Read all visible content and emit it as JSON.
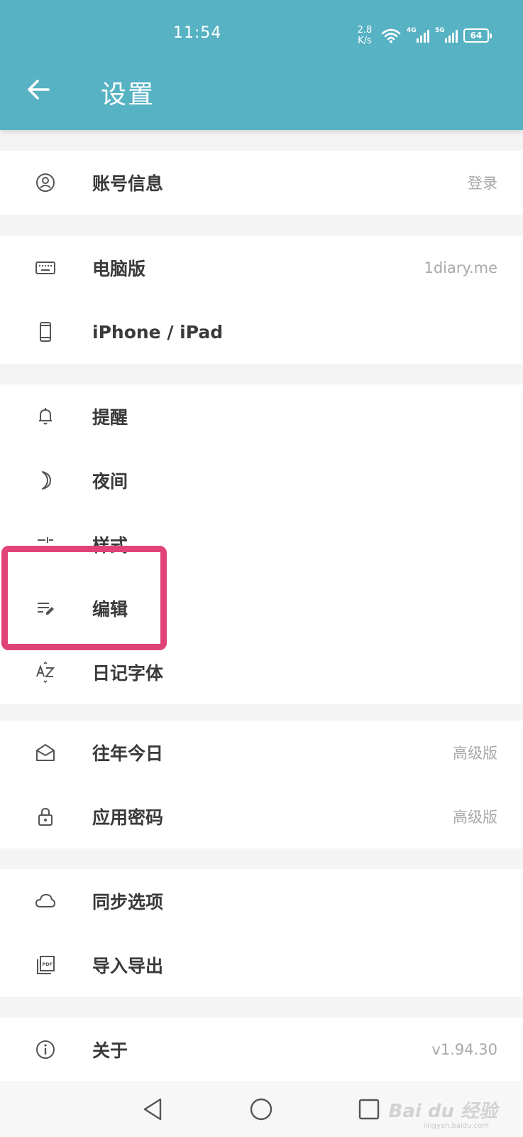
{
  "status_bar": {
    "time": "11:54",
    "net_speed_value": "2.8",
    "net_speed_unit": "K/s",
    "sig1_tag": "4G",
    "sig2_tag": "5G",
    "battery": "64"
  },
  "header": {
    "back_icon": "arrow-left-icon",
    "title": "设置",
    "bg_color": "#57b2c3"
  },
  "groups": [
    {
      "items": [
        {
          "icon": "account-circle-icon",
          "label": "账号信息",
          "value": "登录"
        }
      ]
    },
    {
      "items": [
        {
          "icon": "keyboard-icon",
          "label": "电脑版",
          "value": "1diary.me"
        },
        {
          "icon": "phone-icon",
          "label": "iPhone / iPad",
          "value": ""
        }
      ]
    },
    {
      "items": [
        {
          "icon": "bell-icon",
          "label": "提醒",
          "value": ""
        },
        {
          "icon": "moon-icon",
          "label": "夜间",
          "value": ""
        },
        {
          "icon": "sliders-icon",
          "label": "样式",
          "value": ""
        },
        {
          "icon": "edit-lines-icon",
          "label": "编辑",
          "value": ""
        },
        {
          "icon": "font-az-icon",
          "label": "日记字体",
          "value": ""
        }
      ]
    },
    {
      "items": [
        {
          "icon": "envelope-open-icon",
          "label": "往年今日",
          "value": "高级版"
        },
        {
          "icon": "lock-icon",
          "label": "应用密码",
          "value": "高级版"
        }
      ]
    },
    {
      "items": [
        {
          "icon": "cloud-icon",
          "label": "同步选项",
          "value": ""
        },
        {
          "icon": "pdf-file-icon",
          "label": "导入导出",
          "value": ""
        }
      ]
    },
    {
      "items": [
        {
          "icon": "info-icon",
          "label": "关于",
          "value": "v1.94.30"
        }
      ]
    }
  ],
  "highlight_color": "#e0437a",
  "nav": {
    "back": "triangle-back-icon",
    "home": "circle-home-icon",
    "recent": "square-recent-icon"
  },
  "watermark": {
    "brand": "Bai du 经验",
    "sub": "jingyan.baidu.com"
  }
}
